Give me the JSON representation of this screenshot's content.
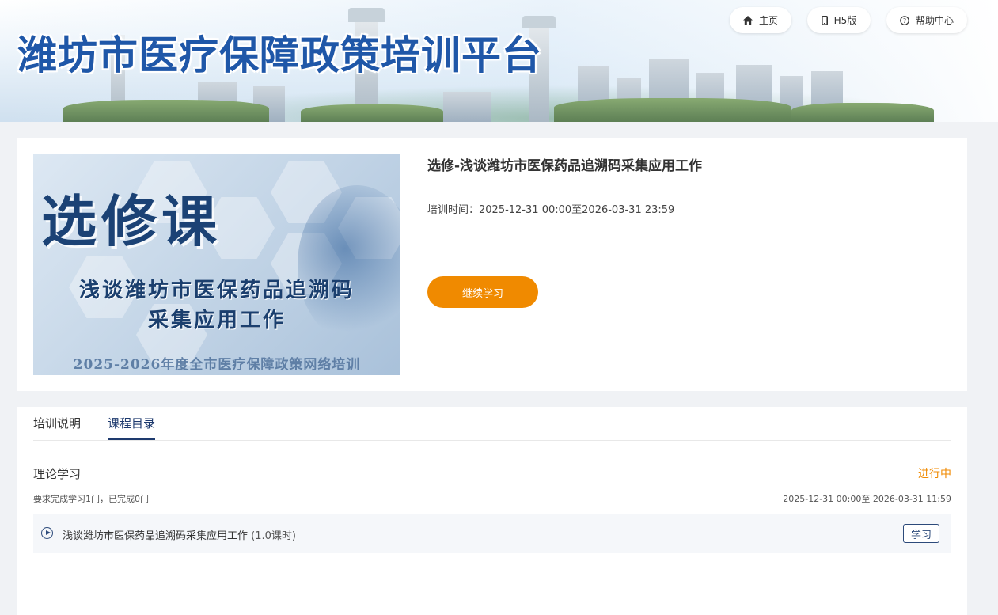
{
  "header": {
    "site_title": "潍坊市医疗保障政策培训平台",
    "nav": [
      {
        "label": "主页",
        "icon": "home-icon"
      },
      {
        "label": "H5版",
        "icon": "mobile-icon"
      },
      {
        "label": "帮助中心",
        "icon": "help-icon"
      }
    ]
  },
  "course": {
    "title": "选修-浅谈潍坊市医保药品追溯码采集应用工作",
    "time_label": "培训时间：",
    "time_value": "2025-12-31 00:00至2026-03-31 23:59",
    "continue_label": "继续学习",
    "cover": {
      "big_text": "选修课",
      "sub_line1": "浅谈潍坊市医保药品追溯码",
      "sub_line2": "采集应用工作",
      "footer": "2025-2026年度全市医疗保障政策网络培训"
    }
  },
  "tabs": [
    {
      "label": "培训说明",
      "active": false
    },
    {
      "label": "课程目录",
      "active": true
    }
  ],
  "section": {
    "title": "理论学习",
    "status": "进行中",
    "requirement": "要求完成学习1门，已完成0门",
    "range": "2025-12-31 00:00至 2026-03-31 11:59",
    "lessons": [
      {
        "name": "浅谈潍坊市医保药品追溯码采集应用工作",
        "hours": "(1.0课时)",
        "action": "学习"
      }
    ]
  },
  "colors": {
    "accent_orange": "#f08a00",
    "title_blue": "#1f57a8",
    "navy": "#1e3a6e"
  }
}
